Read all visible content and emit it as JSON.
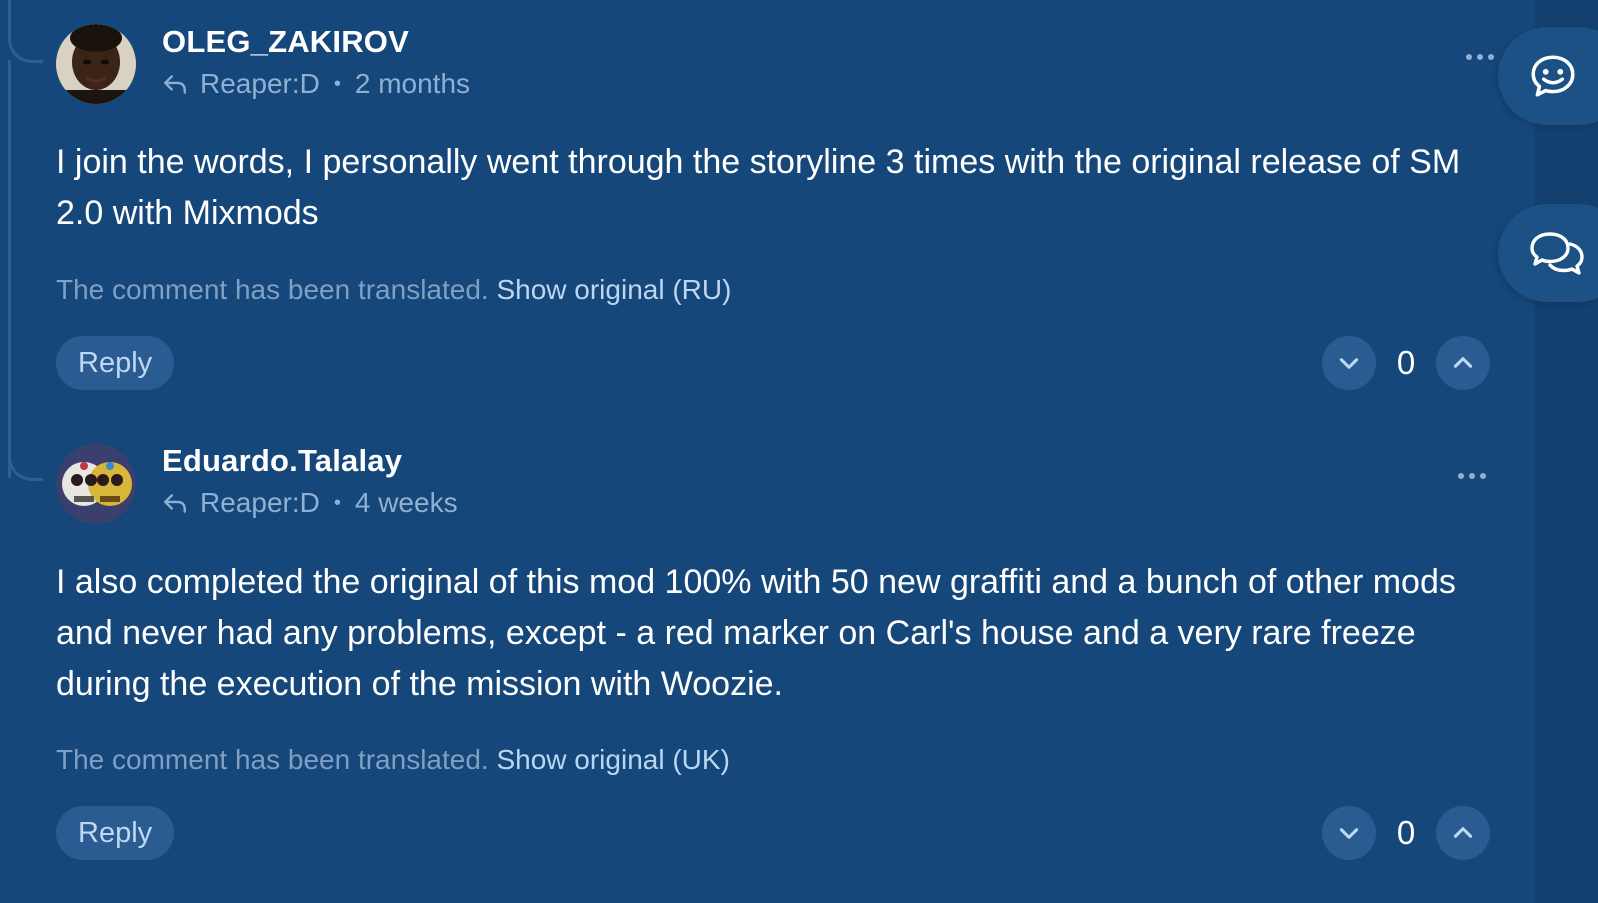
{
  "comments": [
    {
      "author": "OLEG_ZAKIROV",
      "reply_to": "Reaper:D",
      "time": "2 months",
      "text": "I join the words, I personally went through the storyline 3 times with the original release of SM 2.0 with Mixmods",
      "translated_note": "The comment has been translated.",
      "show_original": "Show original (RU)",
      "reply_label": "Reply",
      "votes": "0"
    },
    {
      "author": "Eduardo.Talalay",
      "reply_to": "Reaper:D",
      "time": "4 weeks",
      "text": "I also completed the original of this mod 100% with 50 new graffiti and a bunch of other mods and never had any problems, except - a red marker on Carl's house and a very rare freeze during the execution of the mission with Woozie.",
      "translated_note": "The comment has been translated.",
      "show_original": "Show original (UK)",
      "reply_label": "Reply",
      "votes": "0"
    }
  ],
  "side_buttons": {
    "emoji_icon": "smiley-chat-icon",
    "comments_icon": "chat-bubbles-icon"
  },
  "colors": {
    "background": "#16477a",
    "button": "#2a5c91",
    "muted_text": "#8fb0d2",
    "link": "#bcd6f2"
  }
}
